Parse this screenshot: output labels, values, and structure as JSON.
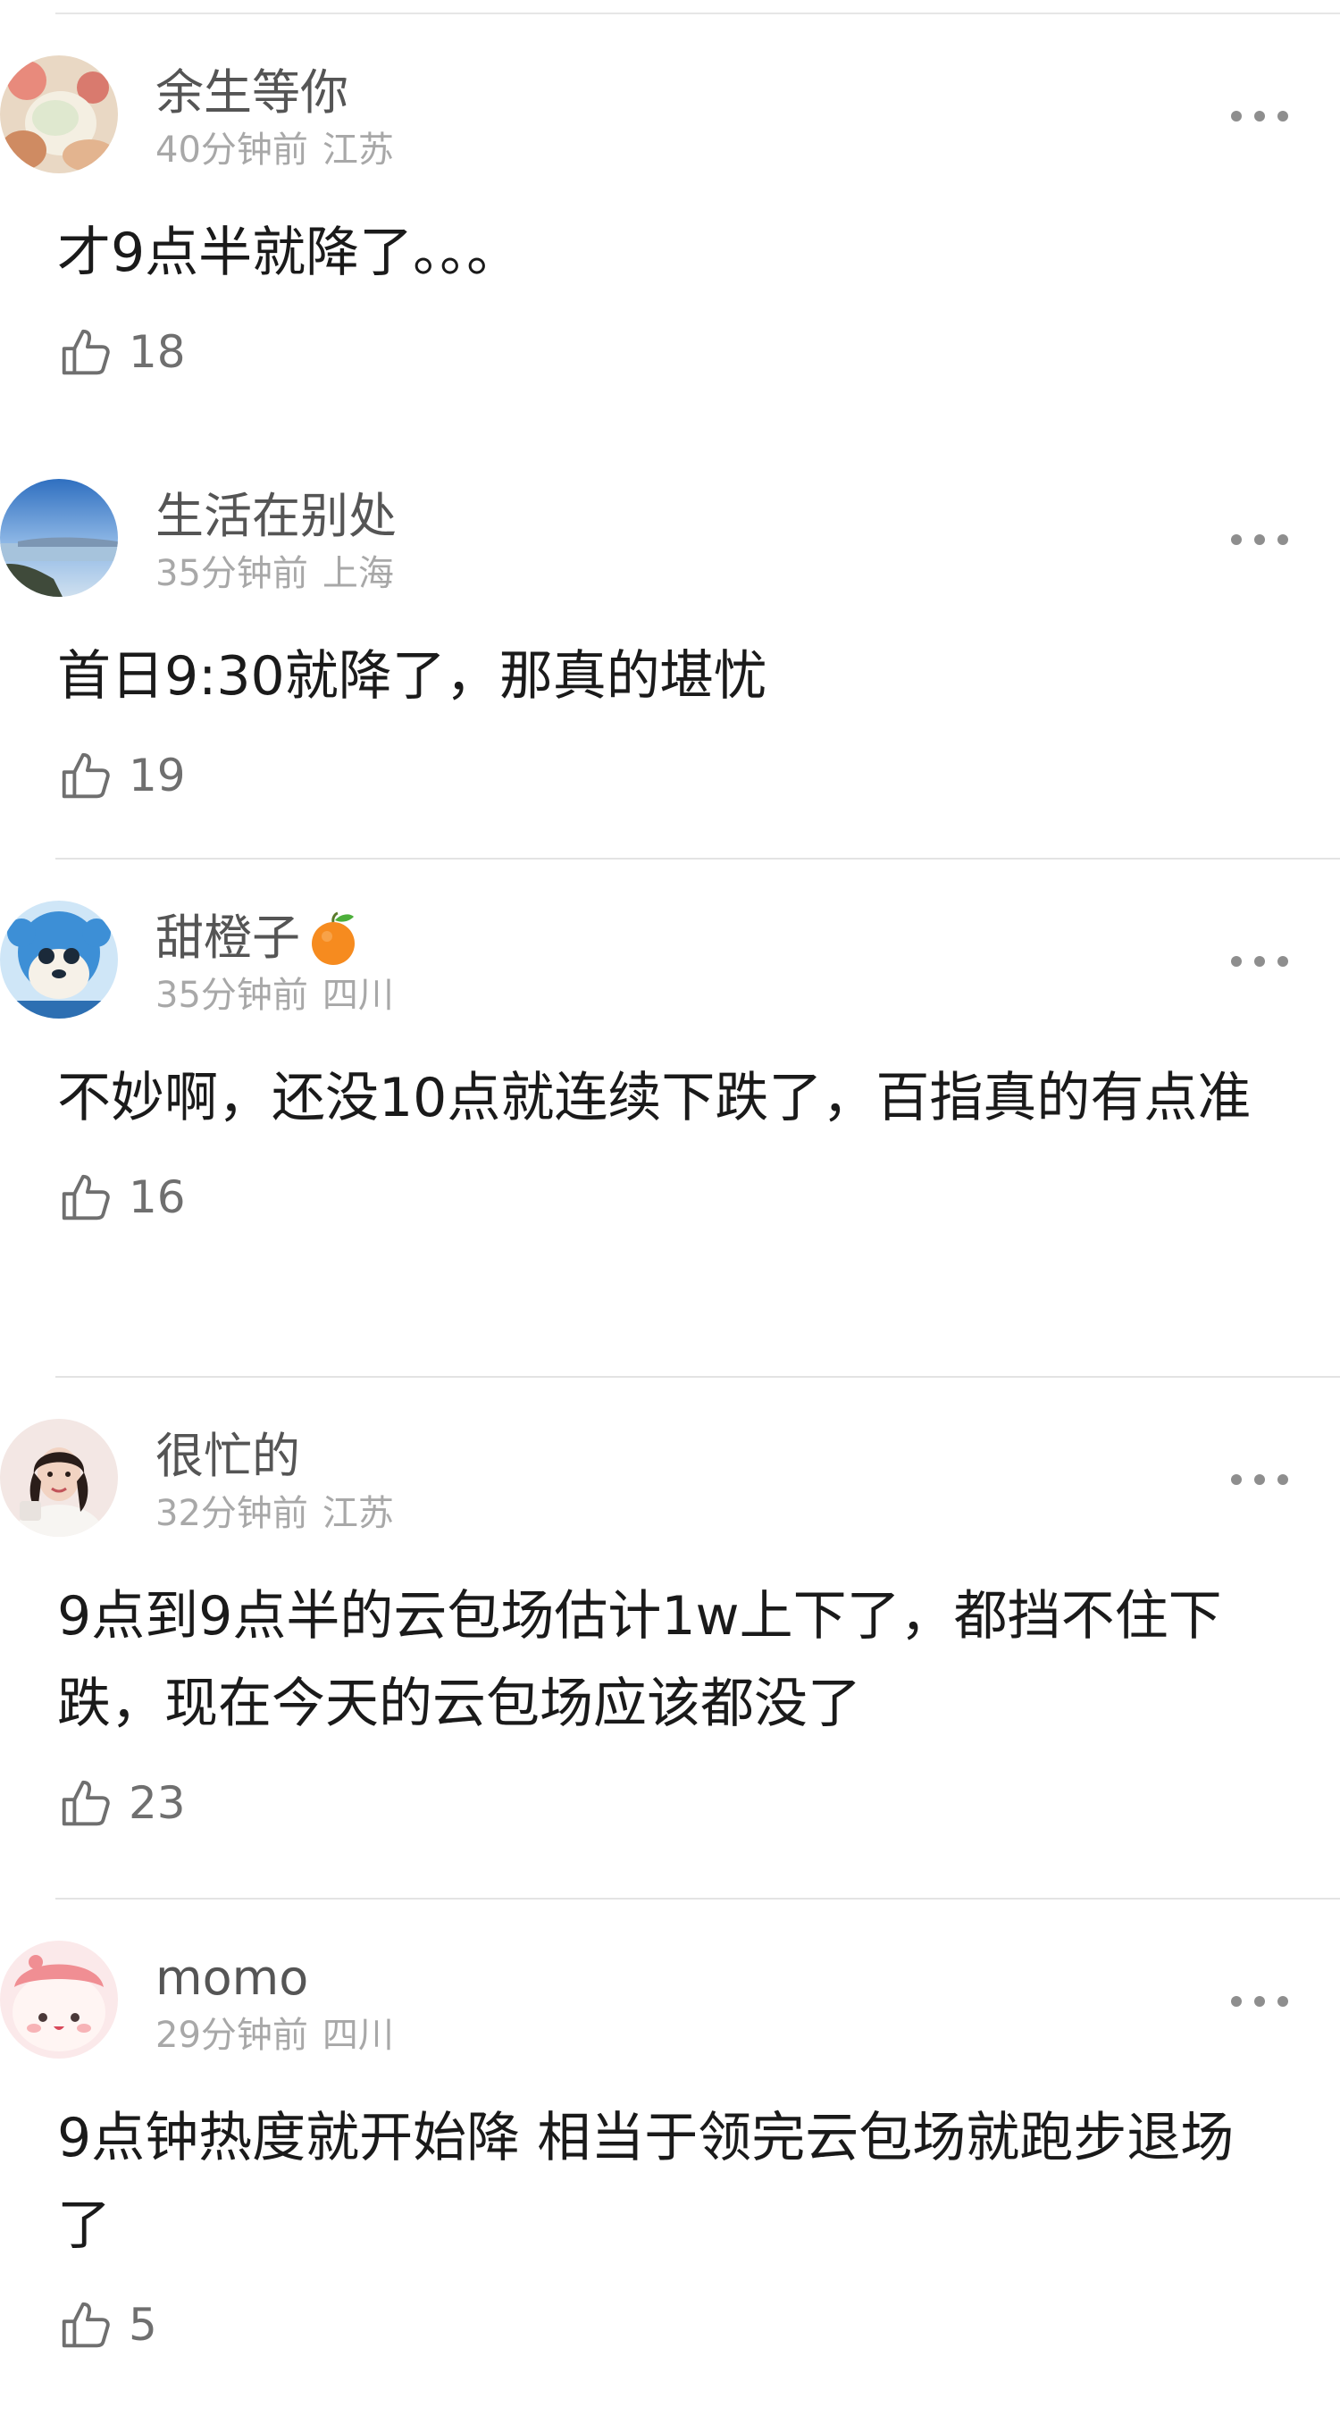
{
  "comments": [
    {
      "username": "余生等你",
      "has_emoji": false,
      "time": "40分钟前",
      "location": "江苏",
      "text": "才9点半就降了。。。",
      "likes": "18"
    },
    {
      "username": "生活在别处",
      "has_emoji": false,
      "time": "35分钟前",
      "location": "上海",
      "text": "首日9:30就降了，那真的堪忧",
      "likes": "19"
    },
    {
      "username": "甜橙子",
      "has_emoji": true,
      "emoji_icon": "tangerine-icon",
      "time": "35分钟前",
      "location": "四川",
      "text": "不妙啊，还没10点就连续下跌了，百指真的有点准",
      "likes": "16"
    },
    {
      "username": "很忙的",
      "has_emoji": false,
      "time": "32分钟前",
      "location": "江苏",
      "text": "9点到9点半的云包场估计1w上下了，都挡不住下跌，现在今天的云包场应该都没了",
      "likes": "23"
    },
    {
      "username": "momo",
      "has_emoji": false,
      "time": "29分钟前",
      "location": "四川",
      "text": "9点钟热度就开始降 相当于领完云包场就跑步退场了",
      "likes": "5"
    }
  ],
  "icons": {
    "like": "thumbs-up-icon",
    "more": "more-dots-icon"
  },
  "colors": {
    "username": "#555555",
    "meta": "#a8a8a8",
    "text": "#1a1a1a",
    "divider": "#e3e3e3"
  }
}
